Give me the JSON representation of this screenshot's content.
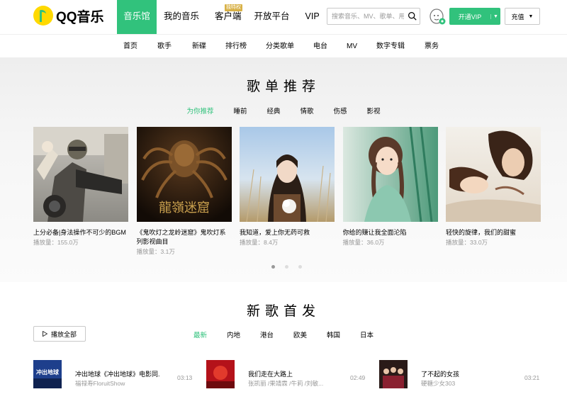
{
  "brand": {
    "name": "QQ音乐"
  },
  "nav": {
    "items": [
      {
        "label": "音乐馆",
        "active": true
      },
      {
        "label": "我的音乐"
      },
      {
        "label": "客户端",
        "badge": "独特权"
      },
      {
        "label": "开放平台"
      },
      {
        "label": "VIP"
      }
    ]
  },
  "search": {
    "placeholder": "搜索音乐、MV、歌单、用户"
  },
  "actions": {
    "vip_label": "开通VIP",
    "charge_label": "充值"
  },
  "subnav": [
    "首页",
    "歌手",
    "新碟",
    "排行榜",
    "分类歌单",
    "电台",
    "MV",
    "数字专辑",
    "票务"
  ],
  "playlists": {
    "title": "歌单推荐",
    "tabs": [
      "为你推荐",
      "睡前",
      "经典",
      "情歌",
      "伤感",
      "影视"
    ],
    "active_tab": "为你推荐",
    "cards": [
      {
        "title": "上分必备|身法操作不可少的BGM",
        "plays": "播放量：155.0万"
      },
      {
        "title": "《鬼吹灯之龙岭迷窟》鬼吹灯系列影视曲目",
        "plays": "播放量：3.1万"
      },
      {
        "title": "我知道，爱上你无药可救",
        "plays": "播放量：8.4万"
      },
      {
        "title": "你给的赚让我全面沦陷",
        "plays": "播放量：36.0万"
      },
      {
        "title": "轻快的旋律，我们的甜蜜",
        "plays": "播放量：33.0万"
      }
    ],
    "cover_text": {
      "card2": "龍嶺迷窟"
    },
    "carousel": {
      "pages": 3,
      "current": 1
    }
  },
  "new_songs": {
    "title": "新歌首发",
    "play_all_label": "播放全部",
    "tabs": [
      "最新",
      "内地",
      "港台",
      "欧美",
      "韩国",
      "日本"
    ],
    "active_tab": "最新",
    "songs": [
      {
        "name": "冲出地球《冲出地球》电影同...",
        "artist": "福禄寿FloruitShow",
        "duration": "03:13"
      },
      {
        "name": "我们走在大路上",
        "artist": "张凯丽 /果靖霖 /牛莉 /刘敏...",
        "duration": "02:49"
      },
      {
        "name": "了不起的女孩",
        "artist": "硬糖少女303",
        "duration": "03:21"
      }
    ],
    "cover_text": {
      "song1": "冲出地球"
    }
  },
  "colors": {
    "accent": "#31c27c",
    "logo": "#ffd900",
    "badge": "#d8b146"
  }
}
